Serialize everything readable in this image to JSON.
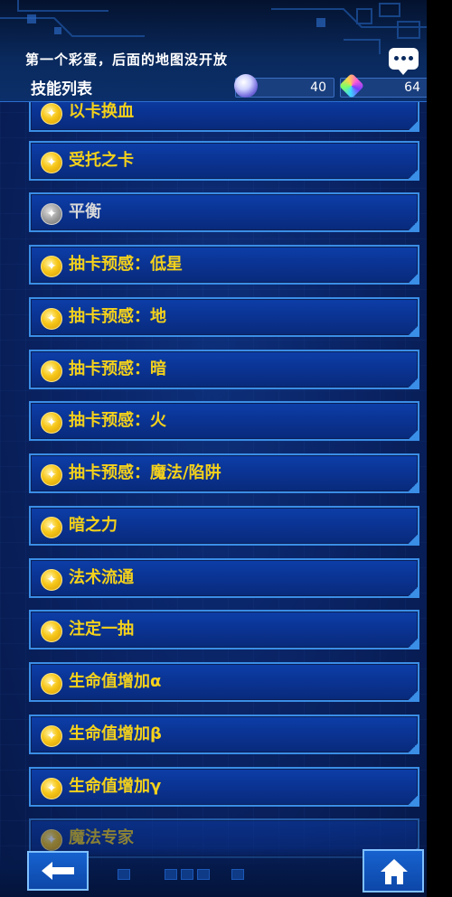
{
  "header": {
    "notice": "第一个彩蛋，后面的地图没开放",
    "title": "技能列表",
    "orb_count": "40",
    "gem_count": "64"
  },
  "skills": [
    {
      "label": "以卡换血",
      "badge": "gold"
    },
    {
      "label": "受托之卡",
      "badge": "gold"
    },
    {
      "label": "平衡",
      "badge": "gray"
    },
    {
      "label": "抽卡预感：低星",
      "badge": "gold"
    },
    {
      "label": "抽卡预感：地",
      "badge": "gold"
    },
    {
      "label": "抽卡预感：暗",
      "badge": "gold"
    },
    {
      "label": "抽卡预感：火",
      "badge": "gold"
    },
    {
      "label": "抽卡预感：魔法/陷阱",
      "badge": "gold"
    },
    {
      "label": "暗之力",
      "badge": "gold"
    },
    {
      "label": "法术流通",
      "badge": "gold"
    },
    {
      "label": "注定一抽",
      "badge": "gold"
    },
    {
      "label": "生命值增加α",
      "badge": "gold"
    },
    {
      "label": "生命值增加β",
      "badge": "gold"
    },
    {
      "label": "生命值增加γ",
      "badge": "gold"
    },
    {
      "label": "魔法专家",
      "badge": "gold"
    }
  ],
  "icons": {
    "chat": "chat-bubble-icon",
    "orb": "orb-currency-icon",
    "gem": "gem-currency-icon",
    "skill_badge": "skill-badge-icon",
    "back": "back-arrow-icon",
    "home": "home-icon"
  },
  "colors": {
    "skill_text": "#f4d11b",
    "skill_text_inactive": "#d8d8d8",
    "panel_border": "#3a8ee6"
  }
}
